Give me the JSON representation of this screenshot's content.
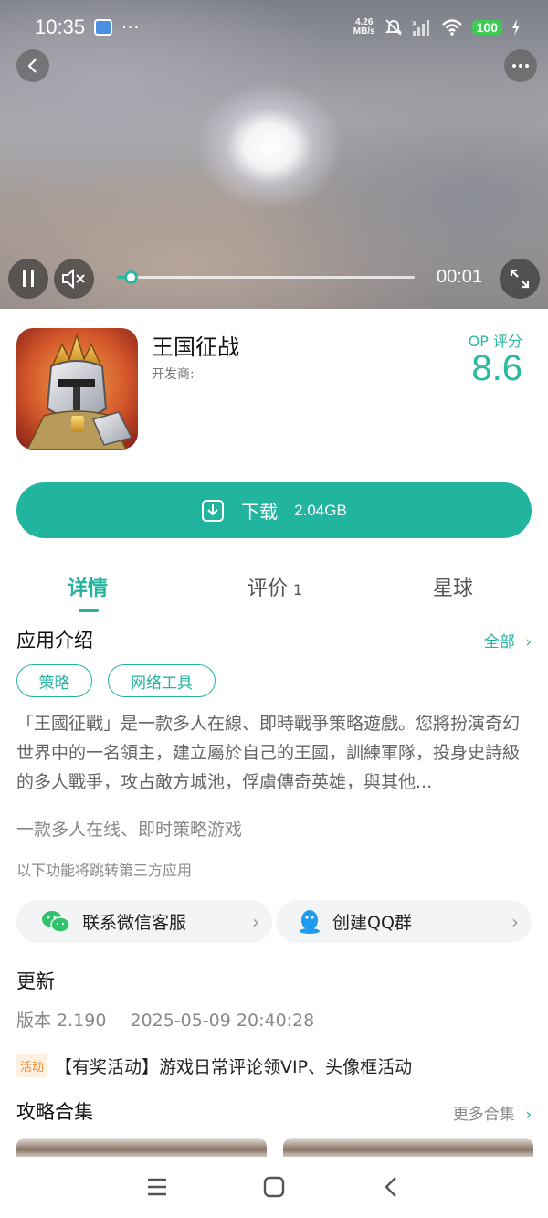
{
  "status_bar": {
    "time": "10:35",
    "dots": "···",
    "network_speed_value": "4.26",
    "network_speed_unit": "MB/s",
    "battery": "100"
  },
  "video": {
    "elapsed": "00:01",
    "progress": 0.047
  },
  "app": {
    "title": "王国征战",
    "developer_label": "开发商:",
    "score_label": "OP 评分",
    "score": "8.6"
  },
  "download": {
    "label": "下载",
    "size": "2.04GB"
  },
  "tabs": [
    {
      "label": "详情",
      "count": ""
    },
    {
      "label": "评价",
      "count": "1"
    },
    {
      "label": "星球",
      "count": ""
    }
  ],
  "intro_section": {
    "title": "应用介绍",
    "more": "全部",
    "tags": [
      "策略",
      "网络工具"
    ],
    "description": "「王國征戰」是一款多人在線、即時戰爭策略遊戲。您將扮演奇幻世界中的一名領主，建立屬於自己的王國，訓練軍隊，投身史詩級的多人戰爭，攻占敵方城池，俘虜傳奇英雄，與其他...",
    "short_description": "一款多人在线、即时策略游戏",
    "third_party_note": "以下功能将跳转第三方应用"
  },
  "contacts": [
    {
      "label": "联系微信客服",
      "icon": "wechat-icon"
    },
    {
      "label": "创建QQ群",
      "icon": "qq-icon"
    }
  ],
  "update_section": {
    "title": "更新",
    "version": "版本 2.190",
    "date": "2025-05-09 20:40:28",
    "activity_badge": "活动",
    "activity_text": "【有奖活动】游戏日常评论领VIP、头像框活动"
  },
  "guides_section": {
    "title": "攻略合集",
    "more": "更多合集"
  },
  "colors": {
    "accent": "#21b5a0",
    "activity_badge": "#f08a2a"
  }
}
